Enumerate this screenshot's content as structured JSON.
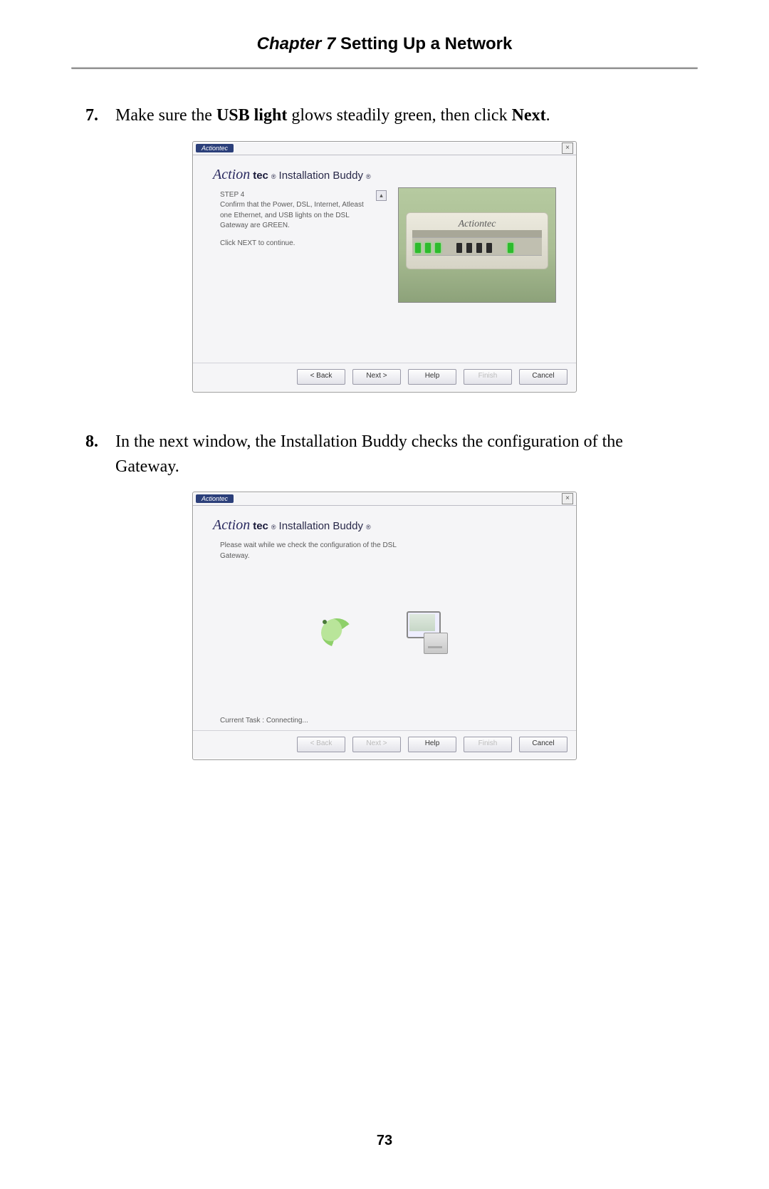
{
  "header": {
    "chapter": "Chapter 7",
    "title": "Setting Up a Network"
  },
  "page_number": "73",
  "steps": [
    {
      "num": "7.",
      "pre": "Make sure the ",
      "bold1": "USB light",
      "mid": " glows steadily green, then click ",
      "bold2": "Next",
      "post": "."
    },
    {
      "num": "8.",
      "text": "In the next window, the Installation Buddy checks the configuration of the Gateway."
    }
  ],
  "wizard_common": {
    "brand_tag": "Actiontec",
    "logo_script": "Action",
    "logo_tec": "tec",
    "reg": "®",
    "app_title": "Installation Buddy",
    "close_glyph": "×",
    "scroll_up": "▴",
    "scroll_down": "▾",
    "buttons": {
      "back": "< Back",
      "next": "Next >",
      "help": "Help",
      "finish": "Finish",
      "cancel": "Cancel"
    }
  },
  "wizard1": {
    "step_label": "STEP 4",
    "text1": "Confirm that the Power, DSL, Internet, Atleast one Ethernet, and USB lights on the DSL Gateway are GREEN.",
    "text2": "Click NEXT to continue.",
    "router_brand": "Actiontec",
    "buttons_state": {
      "back": true,
      "next": true,
      "help": true,
      "finish": false,
      "cancel": true
    }
  },
  "wizard2": {
    "text": "Please wait while we check the configuration of the DSL Gateway.",
    "status": "Current Task : Connecting...",
    "buttons_state": {
      "back": false,
      "next": false,
      "help": true,
      "finish": false,
      "cancel": true
    }
  }
}
